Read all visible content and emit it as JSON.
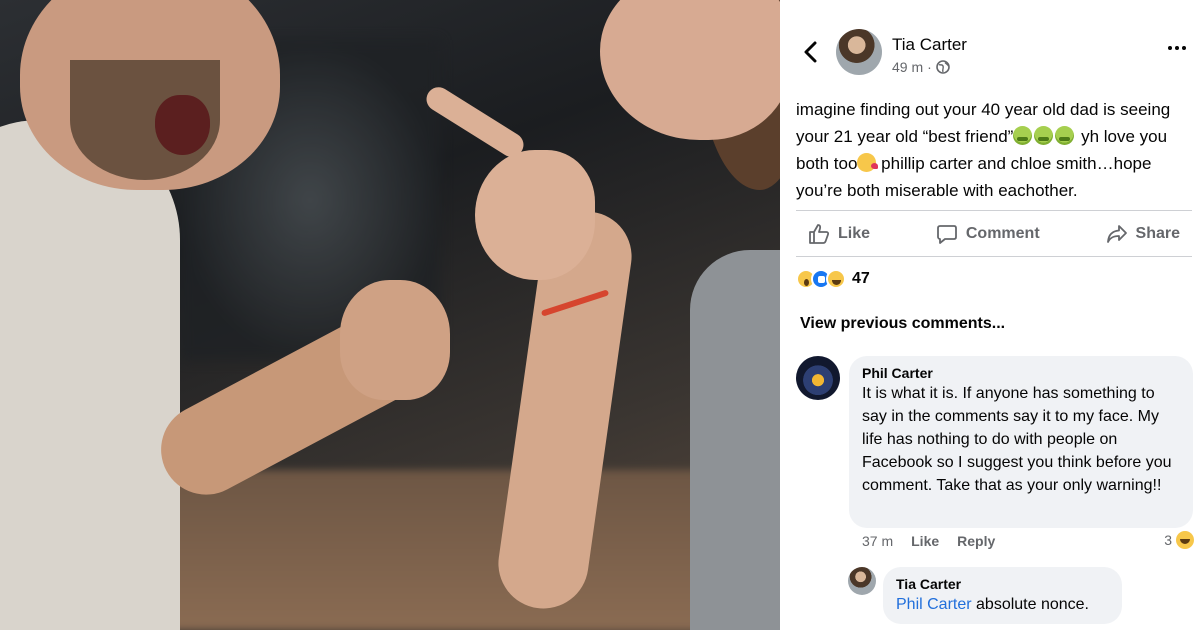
{
  "post": {
    "author": "Tia Carter",
    "time": "49 m",
    "separator": "·",
    "icons": {
      "back": "back-arrow-icon",
      "more": "more-options-icon",
      "audience": "globe-icon"
    },
    "text": {
      "part1": "imagine finding out your 40 year old dad is seeing your 21 year old “best friend”",
      "part2": " yh love you both too",
      "part3": " phillip carter and chloe smith…hope you’re both miserable with eachother."
    }
  },
  "actions": {
    "like": "Like",
    "comment": "Comment",
    "share": "Share"
  },
  "reactions": {
    "types": [
      "wow",
      "like",
      "haha"
    ],
    "count": "47"
  },
  "view_previous": "View previous comments...",
  "comments": [
    {
      "author": "Phil Carter",
      "text": "It is what it is. If anyone has something to say in the comments say it to my face. My life has nothing to do with people on Facebook so I suggest you think before you comment. Take that as your only warning!!",
      "time": "37 m",
      "like": "Like",
      "reply": "Reply",
      "reaction_count": "3"
    },
    {
      "author": "Tia Carter",
      "mention": "Phil Carter",
      "text": " absolute nonce."
    }
  ],
  "colors": {
    "text": "#050505",
    "secondary": "#65676b",
    "link": "#216fdb",
    "bubble": "#f0f2f5",
    "like_blue": "#1877f2"
  }
}
